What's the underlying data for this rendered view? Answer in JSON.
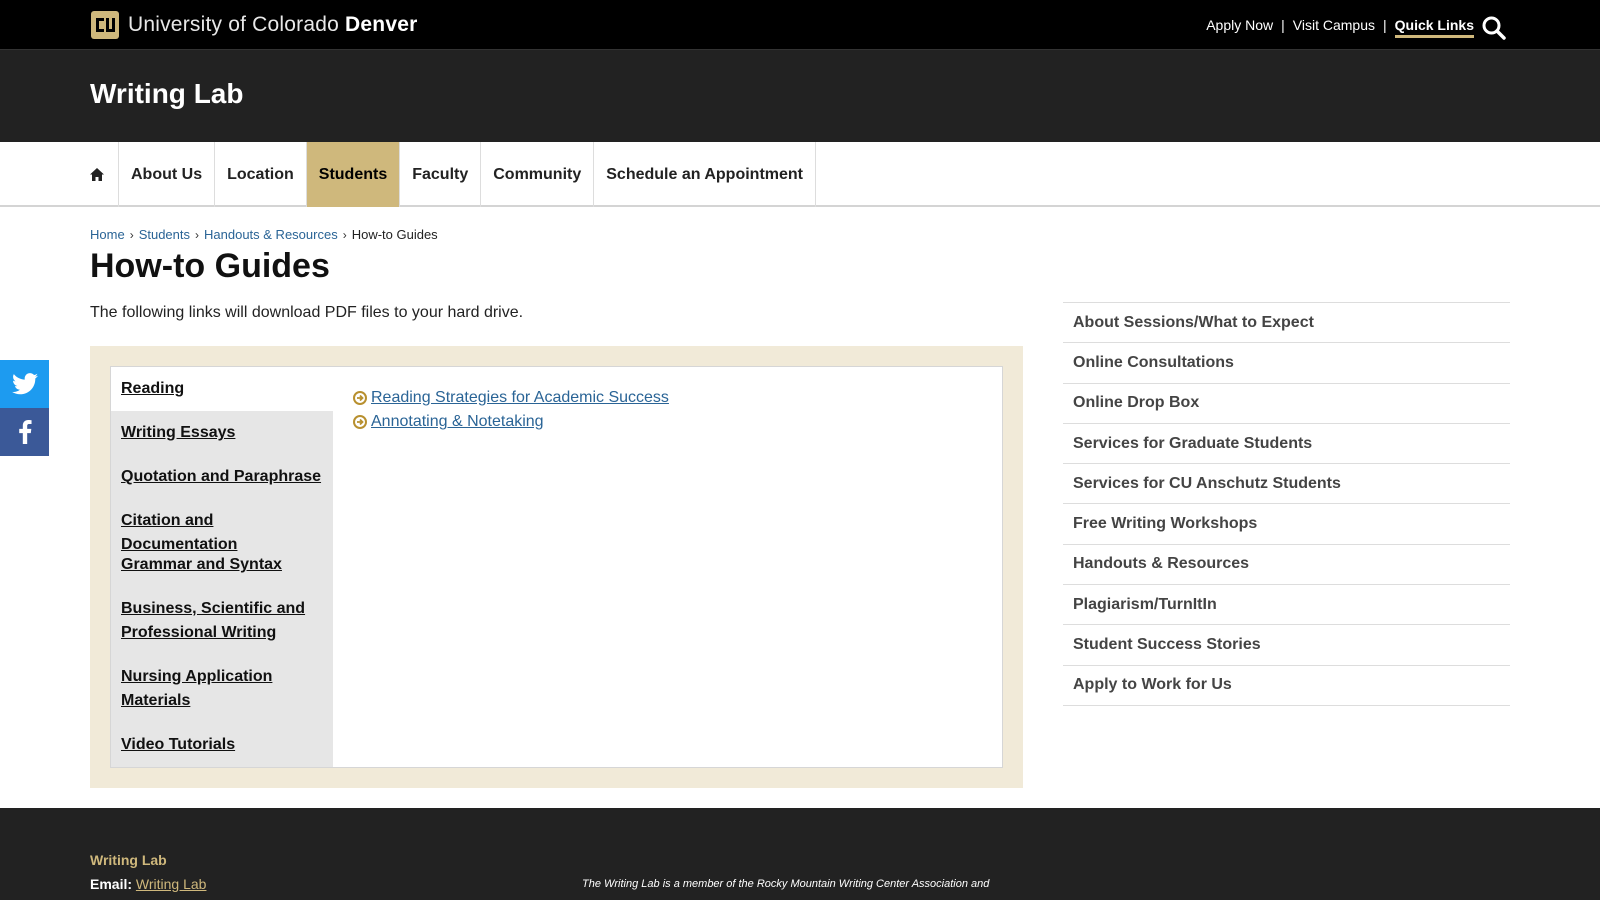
{
  "header": {
    "brand_prefix": "University of Colorado",
    "brand_bold": "Denver",
    "links": [
      "Apply Now",
      "Visit Campus",
      "Quick Links"
    ],
    "separator": "|",
    "search_icon": "search-icon"
  },
  "site": {
    "title": "Writing Lab"
  },
  "nav": {
    "home_icon": "home-icon",
    "items": [
      "About Us",
      "Location",
      "Students",
      "Faculty",
      "Community",
      "Schedule an Appointment"
    ],
    "active": "Students"
  },
  "breadcrumb": {
    "items": [
      "Home",
      "Students",
      "Handouts & Resources"
    ],
    "current": "How-to Guides"
  },
  "page": {
    "title": "How-to Guides",
    "intro": "The following links will download PDF files to your hard drive."
  },
  "tabs": {
    "items": [
      "Reading",
      "Writing Essays",
      "Quotation and Paraphrase",
      "Citation and Documentation",
      "Grammar and Syntax",
      "Business, Scientific and Professional Writing",
      "Nursing Application Materials",
      "Video Tutorials"
    ],
    "active": "Reading",
    "panel_links": [
      "Reading Strategies for Academic Success",
      "Annotating & Notetaking"
    ]
  },
  "sidemenu": {
    "items": [
      "About Sessions/What to Expect",
      "Online Consultations",
      "Online Drop Box",
      "Services for Graduate Students",
      "Services for CU Anschutz Students",
      "Free Writing Workshops",
      "Handouts & Resources",
      "Plagiarism/TurnItIn",
      "Student Success Stories",
      "Apply to Work for Us"
    ]
  },
  "social": {
    "twitter_icon": "twitter-icon",
    "facebook_icon": "facebook-icon"
  },
  "footer": {
    "title": "Writing Lab",
    "email_label": "Email:",
    "email_link": "Writing Lab",
    "note": "The Writing Lab is a member of the Rocky Mountain Writing Center Association and"
  },
  "colors": {
    "gold": "#cfb87c",
    "link_blue": "#2a6496",
    "dark": "#222222",
    "twitter": "#1d9bf0",
    "facebook": "#3b5998"
  }
}
